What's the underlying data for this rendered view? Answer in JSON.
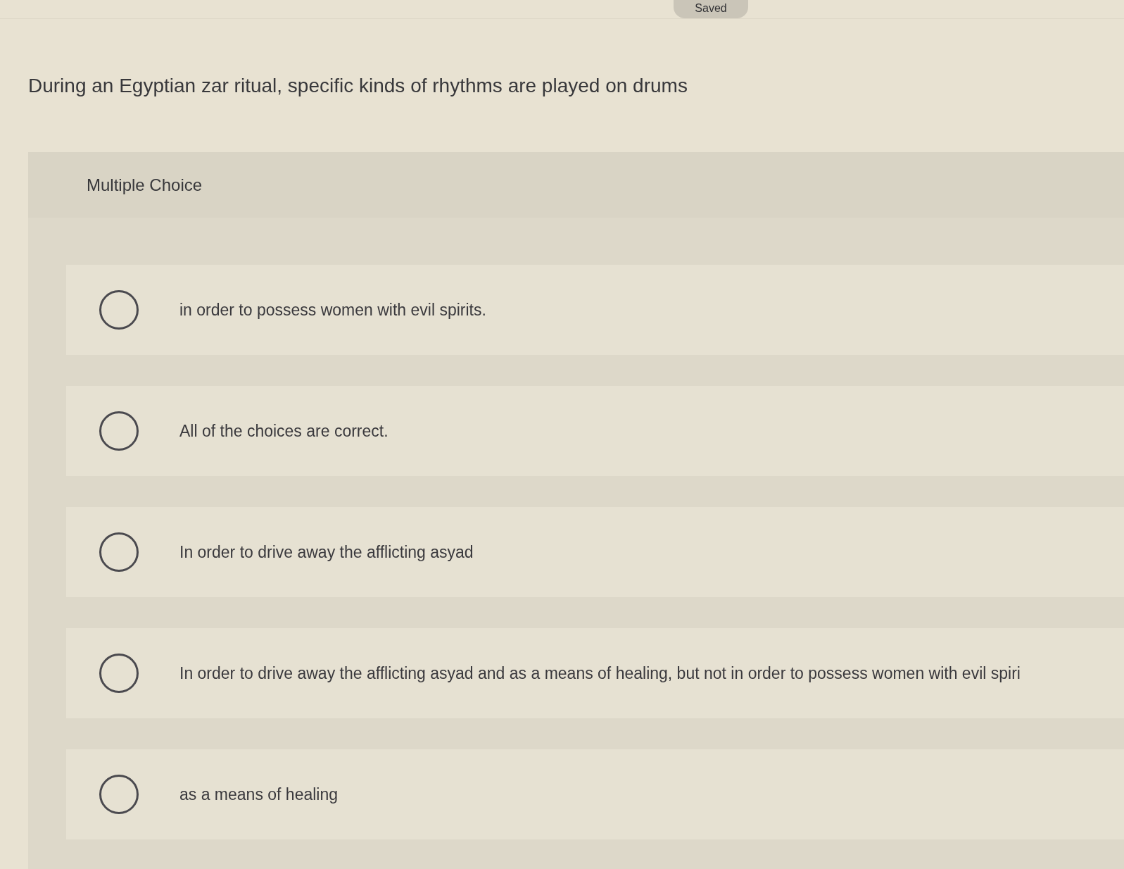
{
  "status_badge": {
    "label": "Saved"
  },
  "question": {
    "prompt": "During an Egyptian zar ritual, specific kinds of rhythms are played on drums"
  },
  "card": {
    "type_label": "Multiple Choice",
    "options": [
      {
        "text": "in order to possess women with evil spirits.",
        "selected": false
      },
      {
        "text": "All of the choices are correct.",
        "selected": false
      },
      {
        "text": "In order to drive away the afflicting asyad",
        "selected": false
      },
      {
        "text": "In order to drive away the afflicting asyad and as a means of healing, but not in order to possess women with evil spiri",
        "selected": false
      },
      {
        "text": "as a means of healing",
        "selected": false
      }
    ]
  }
}
